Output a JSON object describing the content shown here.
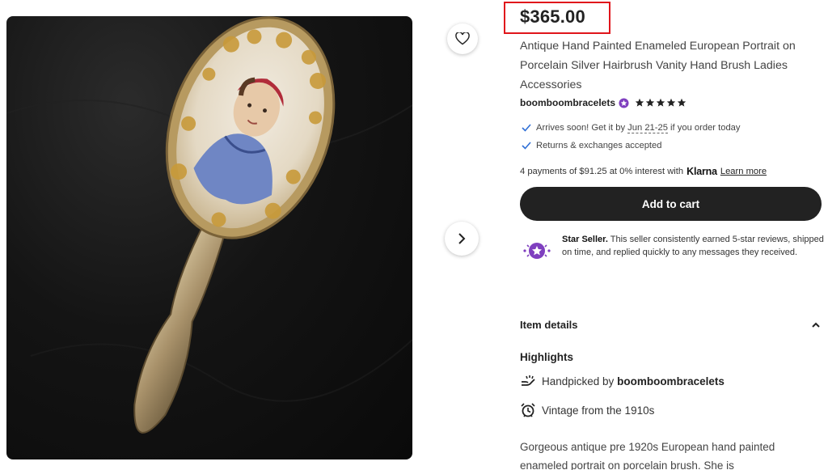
{
  "product": {
    "price": "$365.00",
    "title": "Antique Hand Painted Enameled European Portrait on Porcelain Silver Hairbrush Vanity Hand Brush Ladies Accessories",
    "shop_name": "boomboombracelets",
    "rating_stars": 5
  },
  "delivery": {
    "arrives_prefix": "Arrives soon! Get it by",
    "arrives_dates": "Jun 21-25",
    "arrives_suffix": "if you order today",
    "returns": "Returns & exchanges accepted"
  },
  "klarna": {
    "text": "4 payments of $91.25 at 0% interest with",
    "brand": "Klarna",
    "learn_more": "Learn more"
  },
  "cart": {
    "label": "Add to cart"
  },
  "star_seller": {
    "label": "Star Seller.",
    "description": "This seller consistently earned 5-star reviews, shipped on time, and replied quickly to any messages they received."
  },
  "item_details": {
    "label": "Item details"
  },
  "highlights": {
    "heading": "Highlights",
    "handpicked_prefix": "Handpicked by",
    "handpicked_shop": "boomboombracelets",
    "vintage": "Vintage from the 1910s"
  },
  "description": "Gorgeous antique pre 1920s European hand painted enameled portrait on porcelain brush. She is",
  "colors": {
    "accent": "#222222",
    "price_highlight": "#e0151b",
    "star_seller_purple": "#7f3fbf",
    "check_blue": "#2f6fd6"
  },
  "icons": [
    "heart-icon",
    "chevron-right-icon",
    "check-icon",
    "star-seller-icon",
    "chevron-up-icon",
    "hand-icon",
    "alarm-clock-icon",
    "star-icon"
  ]
}
